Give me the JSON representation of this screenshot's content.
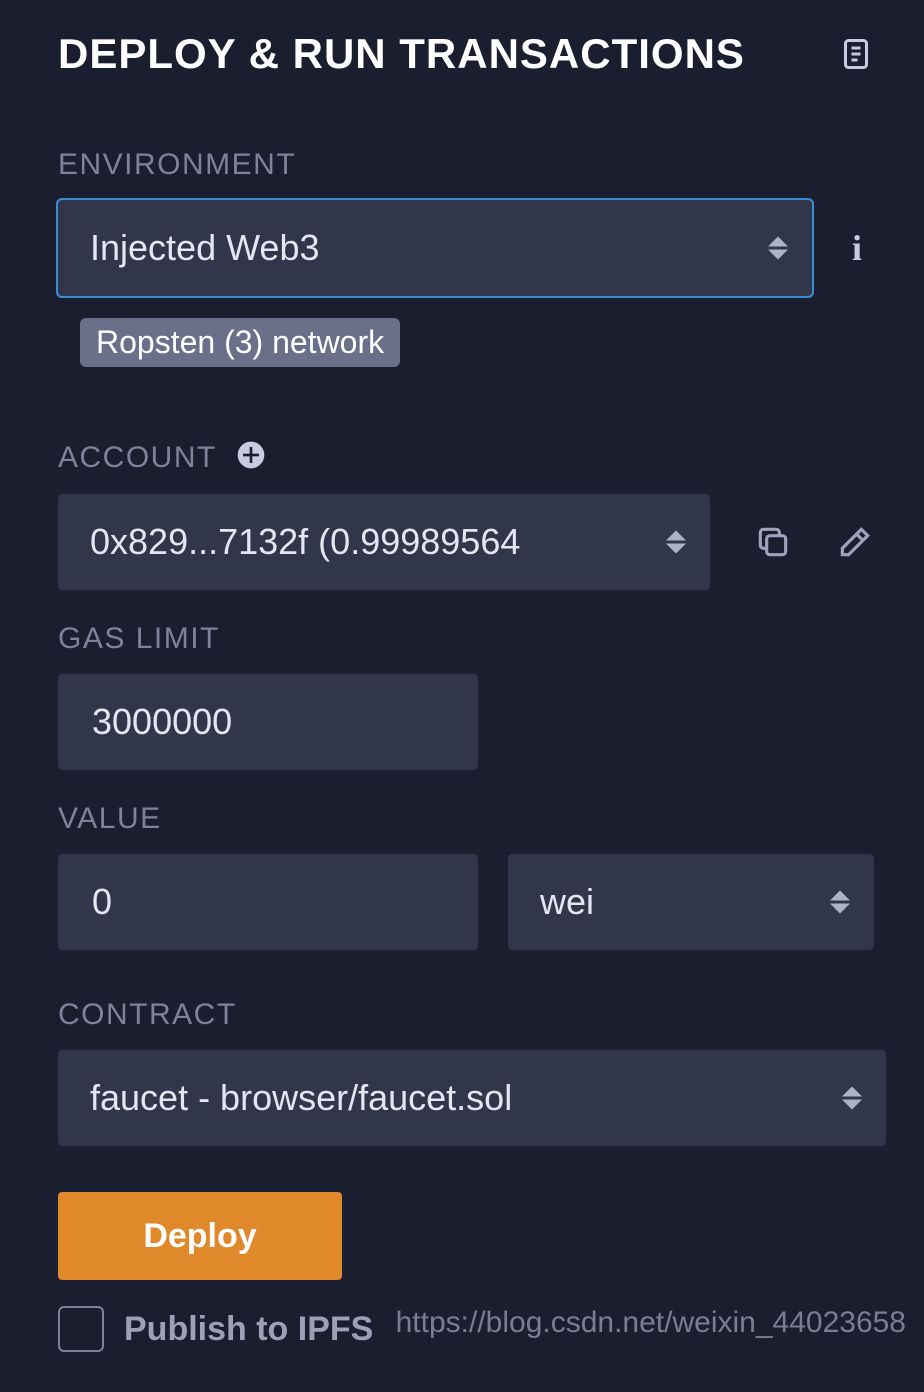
{
  "header": {
    "title": "DEPLOY & RUN TRANSACTIONS"
  },
  "environment": {
    "label": "ENVIRONMENT",
    "selected": "Injected Web3",
    "network_badge": "Ropsten (3) network"
  },
  "account": {
    "label": "ACCOUNT",
    "selected": "0x829...7132f (0.99989564"
  },
  "gas_limit": {
    "label": "GAS LIMIT",
    "value": "3000000"
  },
  "value": {
    "label": "VALUE",
    "amount": "0",
    "unit": "wei"
  },
  "contract": {
    "label": "CONTRACT",
    "selected": "faucet - browser/faucet.sol"
  },
  "actions": {
    "deploy_label": "Deploy",
    "publish_ipfs_label": "Publish to IPFS"
  },
  "watermark": "https://blog.csdn.net/weixin_44023658"
}
